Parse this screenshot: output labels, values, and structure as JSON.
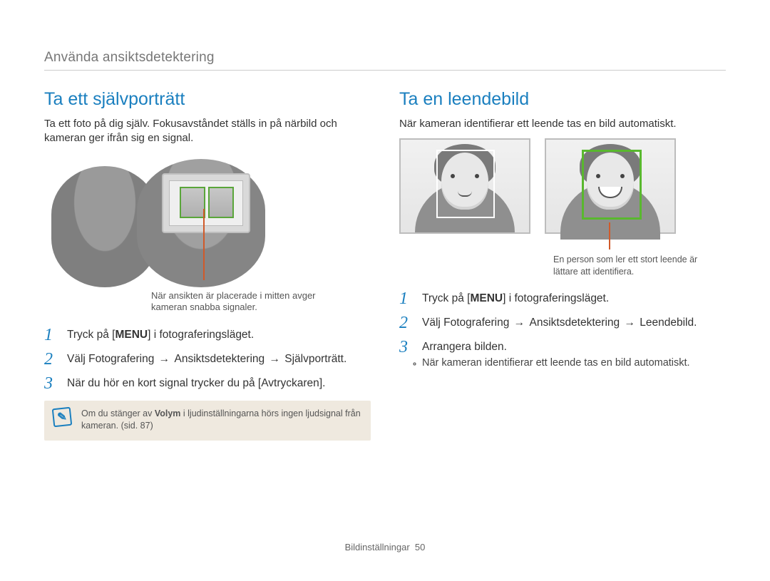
{
  "breadcrumb": "Använda ansiktsdetektering",
  "left": {
    "title": "Ta ett självporträtt",
    "intro": "Ta ett foto på dig själv. Fokusavståndet ställs in på närbild och kameran ger ifrån sig en signal.",
    "callout": "När ansikten är placerade i mitten avger kameran snabba signaler.",
    "steps": {
      "s1_a": "Tryck på [",
      "s1_menu": "MENU",
      "s1_b": "] i fotograferingsläget.",
      "s2_a": "Välj ",
      "s2_b": "Fotografering",
      "s2_arrow1": " → ",
      "s2_c": "Ansiktsdetektering",
      "s2_arrow2": " → ",
      "s2_d": "Självporträtt",
      "s2_e": ".",
      "s3_a": "När du hör en kort signal trycker du på [",
      "s3_b": "Avtryckaren",
      "s3_c": "]."
    },
    "note_a": "Om du stänger av ",
    "note_b": "Volym",
    "note_c": " i ljudinställningarna hörs ingen ljudsignal från kameran. (sid. 87)",
    "nums": {
      "n1": "1",
      "n2": "2",
      "n3": "3"
    }
  },
  "right": {
    "title": "Ta en leendebild",
    "intro": "När kameran identifierar ett leende tas en bild automatiskt.",
    "caption": "En person som ler ett stort leende är lättare att identifiera.",
    "steps": {
      "s1_a": "Tryck på [",
      "s1_menu": "MENU",
      "s1_b": "] i fotograferingsläget.",
      "s2_a": "Välj ",
      "s2_b": "Fotografering",
      "s2_arrow1": " → ",
      "s2_c": "Ansiktsdetektering",
      "s2_arrow2": " → ",
      "s2_d": "Leendebild",
      "s2_e": ".",
      "s3": "Arrangera bilden.",
      "s3_sub": "När kameran identifierar ett leende tas en bild automatiskt."
    },
    "nums": {
      "n1": "1",
      "n2": "2",
      "n3": "3"
    }
  },
  "footer": {
    "section": "Bildinställningar",
    "page": "50"
  },
  "icons": {
    "note": "✎"
  }
}
